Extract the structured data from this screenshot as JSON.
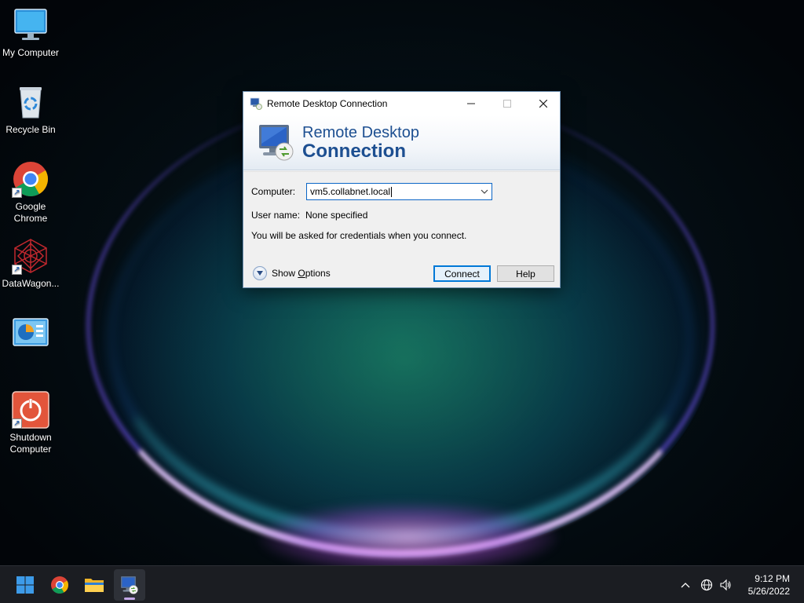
{
  "desktop": {
    "icons": [
      {
        "label_line1": "My Computer",
        "label_line2": "",
        "icon": "monitor-icon"
      },
      {
        "label_line1": "Recycle Bin",
        "label_line2": "",
        "icon": "recycle-bin-icon"
      },
      {
        "label_line1": "Google",
        "label_line2": "Chrome",
        "icon": "chrome-icon"
      },
      {
        "label_line1": "DataWagon...",
        "label_line2": "",
        "icon": "datawagon-icon"
      },
      {
        "label_line1": "",
        "label_line2": "",
        "icon": "control-panel-icon"
      },
      {
        "label_line1": "Shutdown",
        "label_line2": "Computer",
        "icon": "power-icon"
      }
    ]
  },
  "dialog": {
    "title": "Remote Desktop Connection",
    "banner_line1": "Remote Desktop",
    "banner_line2": "Connection",
    "computer_label": "Computer:",
    "computer_value": "vm5.collabnet.local",
    "username_label": "User name:",
    "username_value": "None specified",
    "info_text": "You will be asked for credentials when you connect.",
    "show_options_prefix": "Show ",
    "show_options_underlined": "O",
    "show_options_suffix": "ptions",
    "connect_label": "Connect",
    "help_label": "Help"
  },
  "taskbar": {
    "apps": [
      "start-icon",
      "chrome-icon",
      "file-explorer-icon",
      "remote-desktop-icon"
    ],
    "active_app": "remote-desktop-icon",
    "time": "9:12 PM",
    "date": "5/26/2022"
  }
}
